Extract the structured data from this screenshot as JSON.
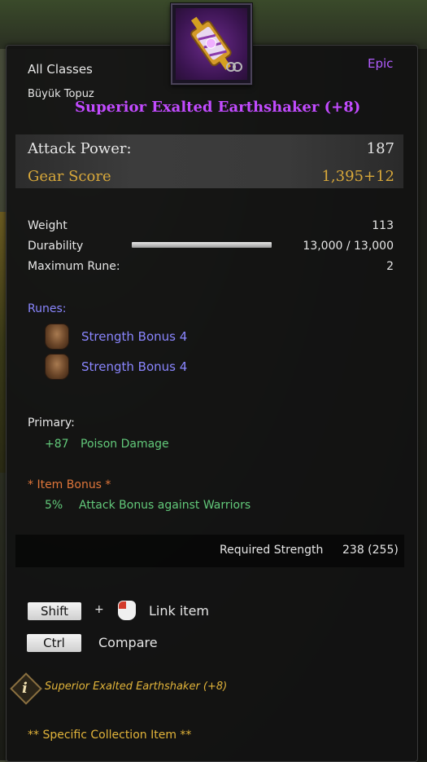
{
  "item": {
    "class_restriction": "All Classes",
    "type_name": "Büyük Topuz",
    "grade": "Epic",
    "name": "Superior Exalted Earthshaker (+8)"
  },
  "stats": {
    "attack_power_label": "Attack Power:",
    "attack_power_value": "187",
    "gear_score_label": "Gear Score",
    "gear_score_value": "1,395+12"
  },
  "properties": {
    "weight_label": "Weight",
    "weight_value": "113",
    "durability_label": "Durability",
    "durability_value": "13,000 / 13,000",
    "durability_fraction": 1.0,
    "max_rune_label": "Maximum Rune:",
    "max_rune_value": "2"
  },
  "runes": {
    "header": "Runes:",
    "items": [
      {
        "name": "Strength Bonus 4",
        "icon": "rune-icon"
      },
      {
        "name": "Strength Bonus 4",
        "icon": "rune-icon"
      }
    ]
  },
  "primary": {
    "header": "Primary:",
    "value": "+87",
    "label": "Poison Damage"
  },
  "item_bonus": {
    "header": "*  Item Bonus *",
    "value": "5%",
    "label": "Attack Bonus against Warriors"
  },
  "requirement": {
    "label": "Required Strength",
    "value": "238 (255)"
  },
  "controls": {
    "shift_key": "Shift",
    "plus": "+",
    "link_label": "Link item",
    "ctrl_key": "Ctrl",
    "compare_label": "Compare"
  },
  "footer": {
    "info_name": "Superior Exalted Earthshaker (+8)",
    "collection": "** Specific Collection Item **"
  },
  "colors": {
    "title": "#c24bff",
    "epic": "#b25cff",
    "gold": "#d8a83a",
    "rune_blue": "#8a86ff",
    "bonus_green": "#62c97a",
    "bonus_orange": "#e0763a"
  }
}
